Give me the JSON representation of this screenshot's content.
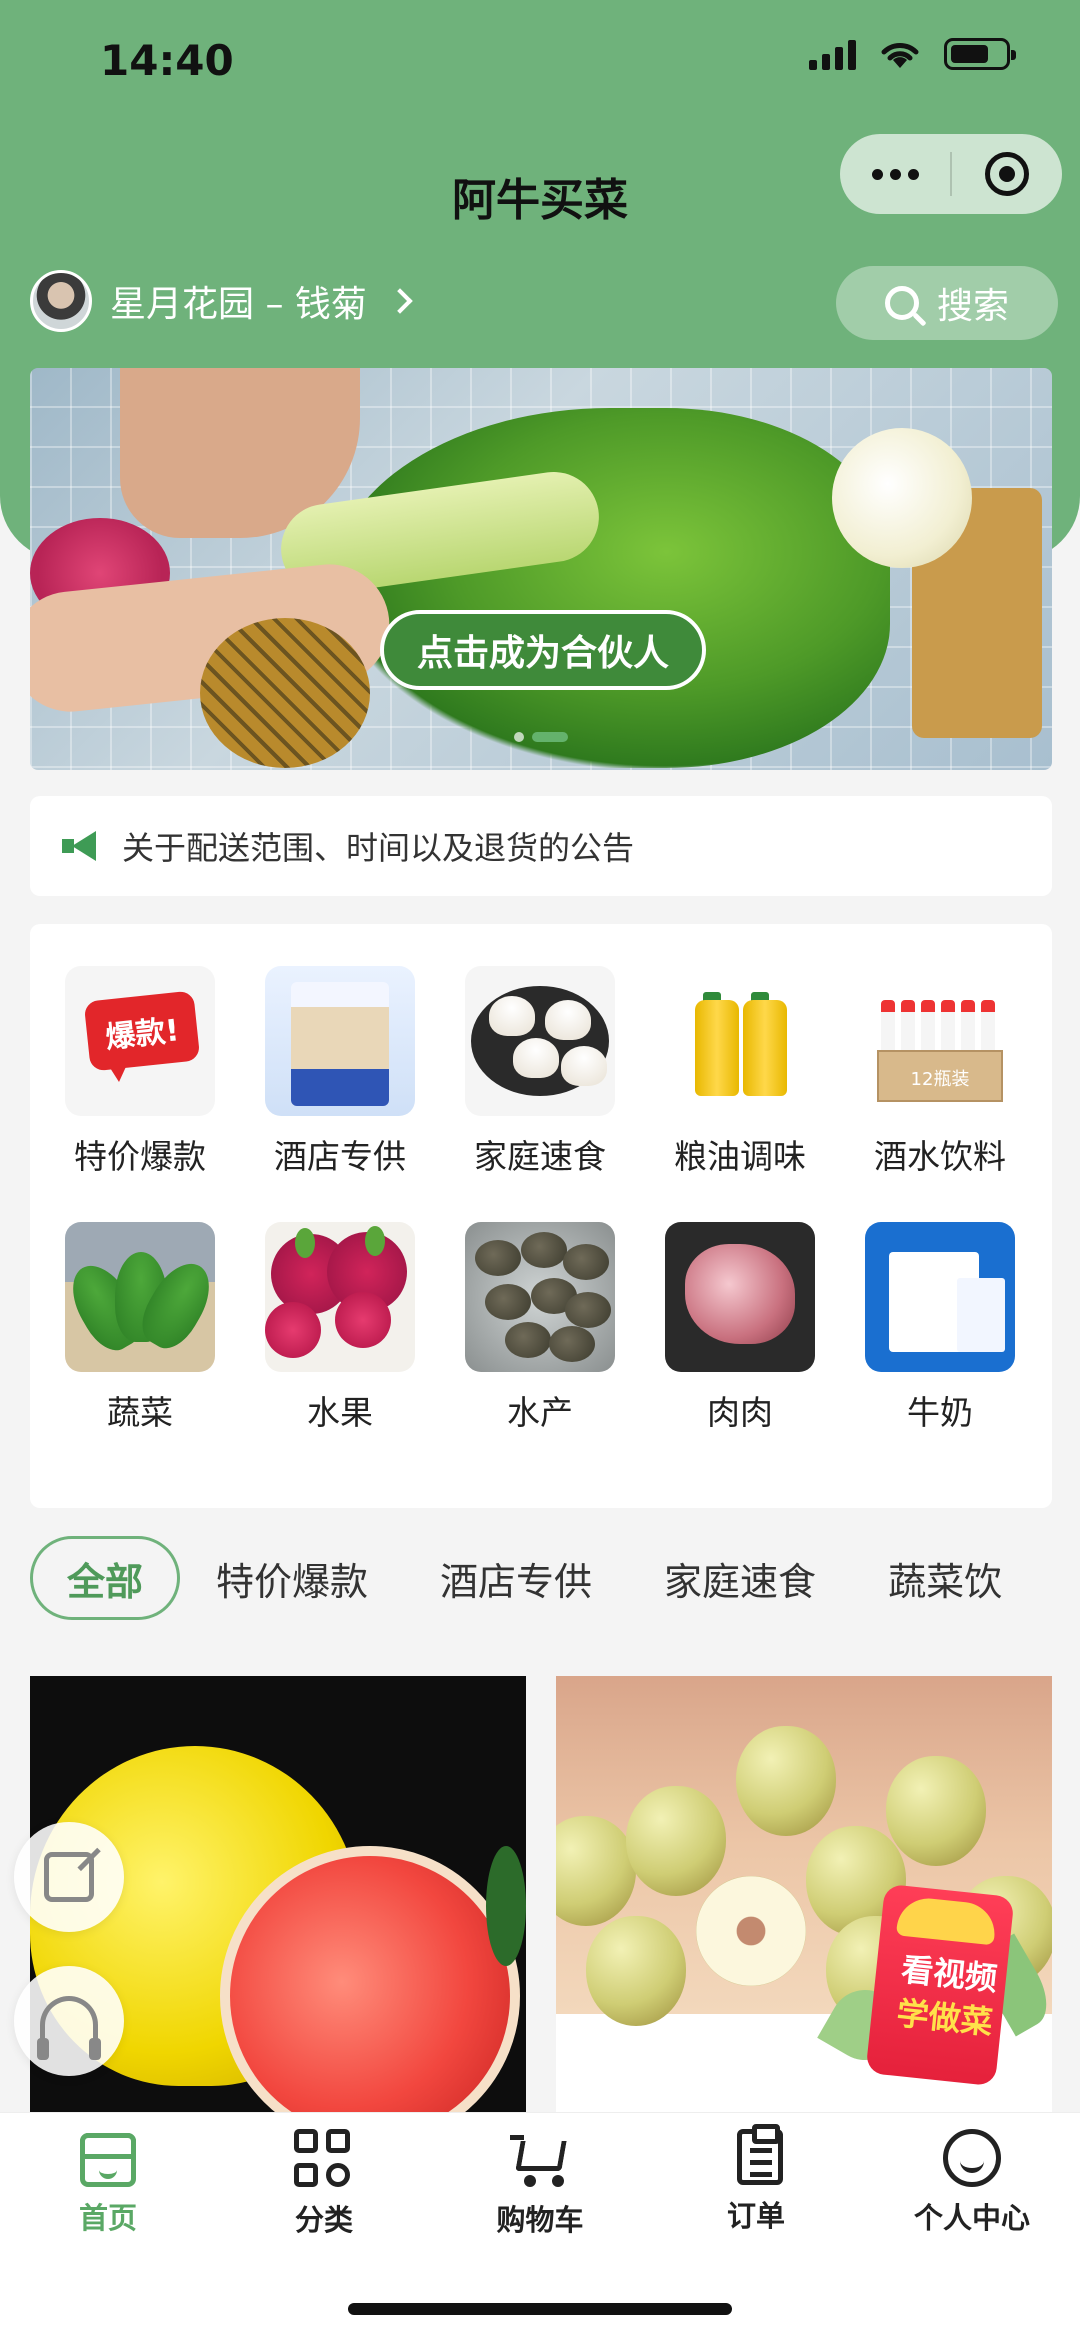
{
  "status_bar": {
    "time": "14:40"
  },
  "header": {
    "title": "阿牛买菜",
    "location": "星月花园 – 钱菊",
    "search_label": "搜索",
    "accent_color": "#6fb27b"
  },
  "banner": {
    "cta_label": "点击成为合伙人",
    "slide_count": 2,
    "active_slide": 2
  },
  "notice": {
    "text": "关于配送范围、时间以及退货的公告"
  },
  "categories": [
    {
      "label": "特价爆款",
      "icon": "hot-deal-bubble",
      "badge_text": "爆款!"
    },
    {
      "label": "酒店专供",
      "icon": "frozen-seafood-bag"
    },
    {
      "label": "家庭速食",
      "icon": "dim-sum-plate"
    },
    {
      "label": "粮油调味",
      "icon": "oil-bottles"
    },
    {
      "label": "酒水饮料",
      "icon": "liquor-box",
      "badge_text": "12瓶装"
    },
    {
      "label": "蔬菜",
      "icon": "bok-choy"
    },
    {
      "label": "水果",
      "icon": "dragon-fruit"
    },
    {
      "label": "水产",
      "icon": "abalone"
    },
    {
      "label": "肉肉",
      "icon": "pork-bones"
    },
    {
      "label": "牛奶",
      "icon": "milk-carton"
    }
  ],
  "tabs": [
    {
      "label": "全部",
      "active": true
    },
    {
      "label": "特价爆款"
    },
    {
      "label": "酒店专供"
    },
    {
      "label": "家庭速食"
    },
    {
      "label": "蔬菜饮"
    }
  ],
  "products": [
    {
      "image": "pomelo"
    },
    {
      "image": "green-jujube"
    }
  ],
  "promo": {
    "line1": "看视频",
    "line2": "学做菜"
  },
  "float_buttons": [
    "share-icon",
    "headset-icon"
  ],
  "bottom_nav": [
    {
      "label": "首页",
      "icon": "home-store-icon",
      "active": true
    },
    {
      "label": "分类",
      "icon": "category-grid-icon"
    },
    {
      "label": "购物车",
      "icon": "cart-icon"
    },
    {
      "label": "订单",
      "icon": "order-clipboard-icon"
    },
    {
      "label": "个人中心",
      "icon": "smiley-profile-icon"
    }
  ]
}
